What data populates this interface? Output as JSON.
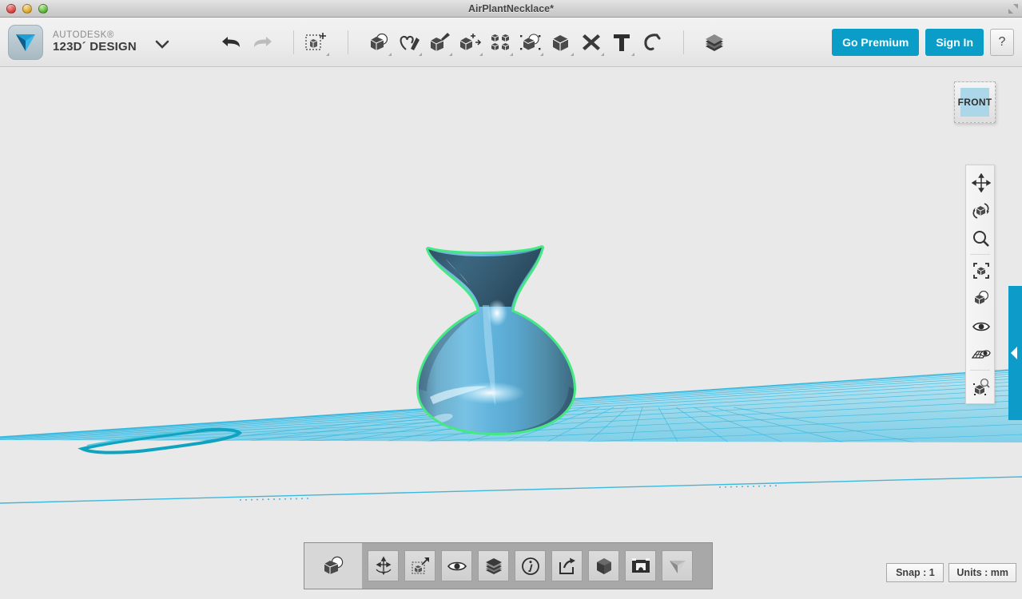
{
  "window": {
    "title": "AirPlantNecklace*",
    "controls": [
      "close-button",
      "minimize-button",
      "maximize-button"
    ],
    "resize_icon": "resize-corner-icon"
  },
  "brand": {
    "logo_icon": "autodesk-123d-logo-icon",
    "line1": "AUTODESK®",
    "line2": "123D´ DESIGN",
    "caret_icon": "chevron-down-icon"
  },
  "toolbar": {
    "history": [
      {
        "name": "undo-button",
        "icon": "undo-arrow-icon",
        "label": "Undo",
        "enabled": true
      },
      {
        "name": "redo-button",
        "icon": "redo-arrow-icon",
        "label": "Redo",
        "enabled": false
      }
    ],
    "transform": [
      {
        "name": "transform-tool",
        "icon": "cube-move-icon",
        "label": "Transform"
      }
    ],
    "tools": [
      {
        "name": "primitives-tool",
        "icon": "cube-sphere-icon",
        "label": "Primitives"
      },
      {
        "name": "sketch-tool",
        "icon": "heart-pen-icon",
        "label": "Sketch"
      },
      {
        "name": "construct-tool",
        "icon": "cube-brush-icon",
        "label": "Construct"
      },
      {
        "name": "modify-tool",
        "icon": "cube-arrows-icon",
        "label": "Modify"
      },
      {
        "name": "pattern-tool",
        "icon": "four-cubes-icon",
        "label": "Pattern"
      },
      {
        "name": "grouping-tool",
        "icon": "cube-sphere-dotted-icon",
        "label": "Grouping"
      },
      {
        "name": "combine-tool",
        "icon": "cube-solid-icon",
        "label": "Combine"
      },
      {
        "name": "measure-tool",
        "icon": "ruler-pencil-icon",
        "label": "Measure"
      },
      {
        "name": "text-tool",
        "icon": "text-t-icon",
        "label": "Text"
      },
      {
        "name": "snap-tool",
        "icon": "magnet-icon",
        "label": "Snap"
      }
    ],
    "layers": [
      {
        "name": "materials-tool",
        "icon": "layers-stack-icon",
        "label": "Material"
      }
    ]
  },
  "account": {
    "go_premium": "Go Premium",
    "sign_in": "Sign In",
    "help": "?",
    "accent_color": "#0a9dc7"
  },
  "viewport": {
    "view_cube": {
      "label": "FRONT",
      "face_color": "#abd7e8"
    },
    "grid": {
      "color": "#29b6dd",
      "fill": "#8ed8ec",
      "rows": 17,
      "cols": 22
    },
    "model": {
      "name": "air-plant-vase",
      "selected": true,
      "selection_color": "#4cea85",
      "body_color": "#5ab6e0",
      "shade_color": "#44708a"
    },
    "sketch": {
      "name": "profile-sketch",
      "color": "#14a5bf"
    },
    "panel_tab": {
      "name": "panel-collapse-tab",
      "color": "#0d9cc9",
      "icon": "chevron-left-icon"
    }
  },
  "nav_toolbar": {
    "groups": [
      [
        {
          "name": "pan-tool",
          "icon": "four-way-arrows-icon",
          "label": "Pan"
        },
        {
          "name": "orbit-tool",
          "icon": "orbit-cube-icon",
          "label": "Orbit"
        },
        {
          "name": "zoom-tool",
          "icon": "magnifier-icon",
          "label": "Zoom"
        }
      ],
      [
        {
          "name": "fit-to-view-tool",
          "icon": "cube-brackets-icon",
          "label": "Fit"
        },
        {
          "name": "view-style-tool",
          "icon": "cube-sphere-icon",
          "label": "Display"
        },
        {
          "name": "visibility-tool",
          "icon": "eye-icon",
          "label": "Visibility"
        },
        {
          "name": "grid-view-tool",
          "icon": "grid-eye-icon",
          "label": "Grid / Snap"
        }
      ],
      [
        {
          "name": "material-paint-tool",
          "icon": "cube-magnifier-icon",
          "label": "Inspect"
        }
      ]
    ]
  },
  "bottom_toolbar": {
    "active": {
      "name": "primitives-button",
      "icon": "cube-sphere-icon",
      "label": "Primitives"
    },
    "items": [
      {
        "name": "transform-button",
        "icon": "four-way-arrows-arc-icon",
        "label": "Transform"
      },
      {
        "name": "scale-button",
        "icon": "cube-dotted-arrow-icon",
        "label": "Scale"
      },
      {
        "name": "visibility-button",
        "icon": "eye-icon",
        "label": "Visibility"
      },
      {
        "name": "material-button",
        "icon": "layers-stack-icon",
        "label": "Material"
      },
      {
        "name": "info-button",
        "icon": "info-circle-icon",
        "label": "Info"
      },
      {
        "name": "export-button",
        "icon": "share-export-icon",
        "label": "Export"
      },
      {
        "name": "render-button",
        "icon": "polyhedron-icon",
        "label": "Render"
      },
      {
        "name": "snapshot-button",
        "icon": "camera-icon",
        "label": "Snapshot"
      },
      {
        "name": "view-button",
        "icon": "view-pyramid-icon",
        "label": "View"
      }
    ]
  },
  "status_bar": {
    "snap": "Snap : 1",
    "units": "Units : mm"
  }
}
